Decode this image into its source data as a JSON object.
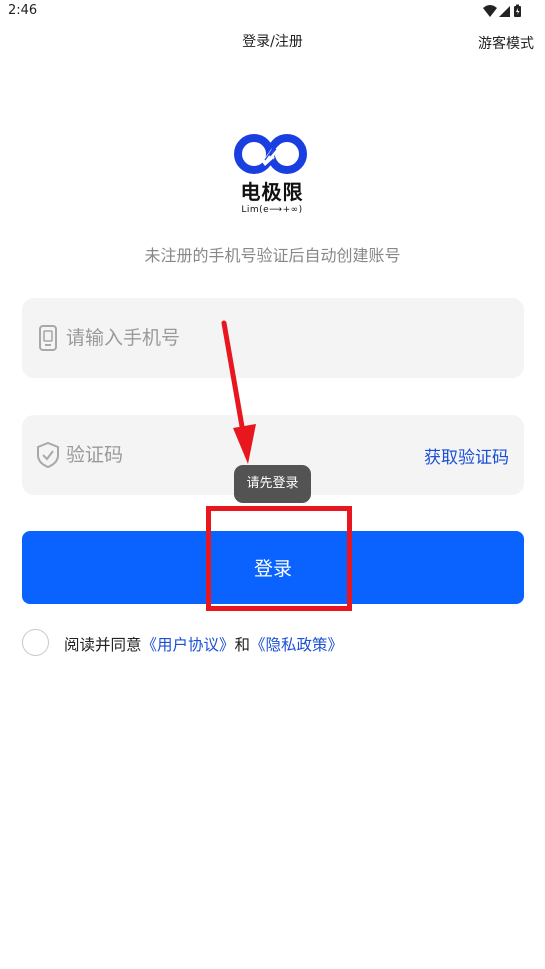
{
  "status_bar": {
    "time": "2:46",
    "icons": [
      "wifi-icon",
      "signal-icon",
      "battery-icon"
    ]
  },
  "header": {
    "title": "登录/注册",
    "guest_mode": "游客模式"
  },
  "logo": {
    "name_cn": "电极限",
    "subtitle": "Lim(e⟶+∞)"
  },
  "subtitle": "未注册的手机号验证后自动创建账号",
  "phone_field": {
    "placeholder": "请输入手机号",
    "value": "",
    "icon": "phone-icon"
  },
  "code_field": {
    "placeholder": "验证码",
    "value": "",
    "icon": "shield-icon",
    "get_code_label": "获取验证码"
  },
  "toast": "请先登录",
  "login_button": "登录",
  "agreement": {
    "prefix": "阅读并同意",
    "user_agreement": "《用户协议》",
    "conjunction": "和",
    "privacy_policy": "《隐私政策》",
    "checked": false
  },
  "colors": {
    "primary": "#0a63ff",
    "link": "#1a4fd6",
    "annotation": "#e8161e",
    "field_bg": "#f4f4f4"
  }
}
